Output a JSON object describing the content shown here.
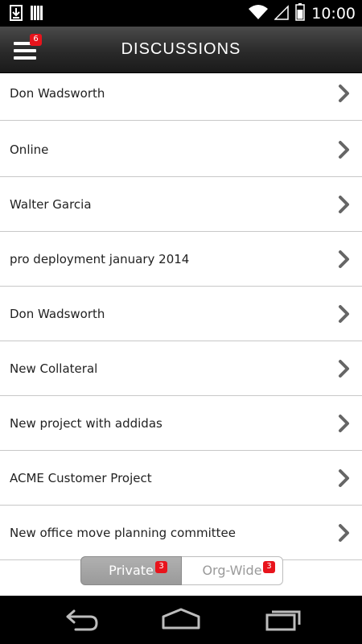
{
  "status_bar": {
    "time": "10:00",
    "icons": [
      "download-icon",
      "signal-bars-icon",
      "wifi-icon",
      "cell-signal-icon",
      "battery-icon"
    ]
  },
  "header": {
    "title": "DISCUSSIONS",
    "menu_badge": "6"
  },
  "discussions": [
    {
      "label": "Don Wadsworth"
    },
    {
      "label": "Online"
    },
    {
      "label": "Walter Garcia"
    },
    {
      "label": "pro deployment january 2014"
    },
    {
      "label": "Don Wadsworth"
    },
    {
      "label": "New Collateral"
    },
    {
      "label": "New project with addidas"
    },
    {
      "label": "ACME Customer Project"
    },
    {
      "label": "New office move planning committee"
    }
  ],
  "segments": {
    "private": {
      "label": "Private",
      "badge": "3"
    },
    "org_wide": {
      "label": "Org-Wide",
      "badge": "3"
    }
  },
  "colors": {
    "badge": "#e8141c",
    "header_top": "#4a4a4a",
    "header_bottom": "#1a1a1a",
    "divider": "#c8c8c8",
    "chevron": "#666666"
  },
  "nav_icons": [
    "back-icon",
    "home-icon",
    "recent-apps-icon"
  ]
}
